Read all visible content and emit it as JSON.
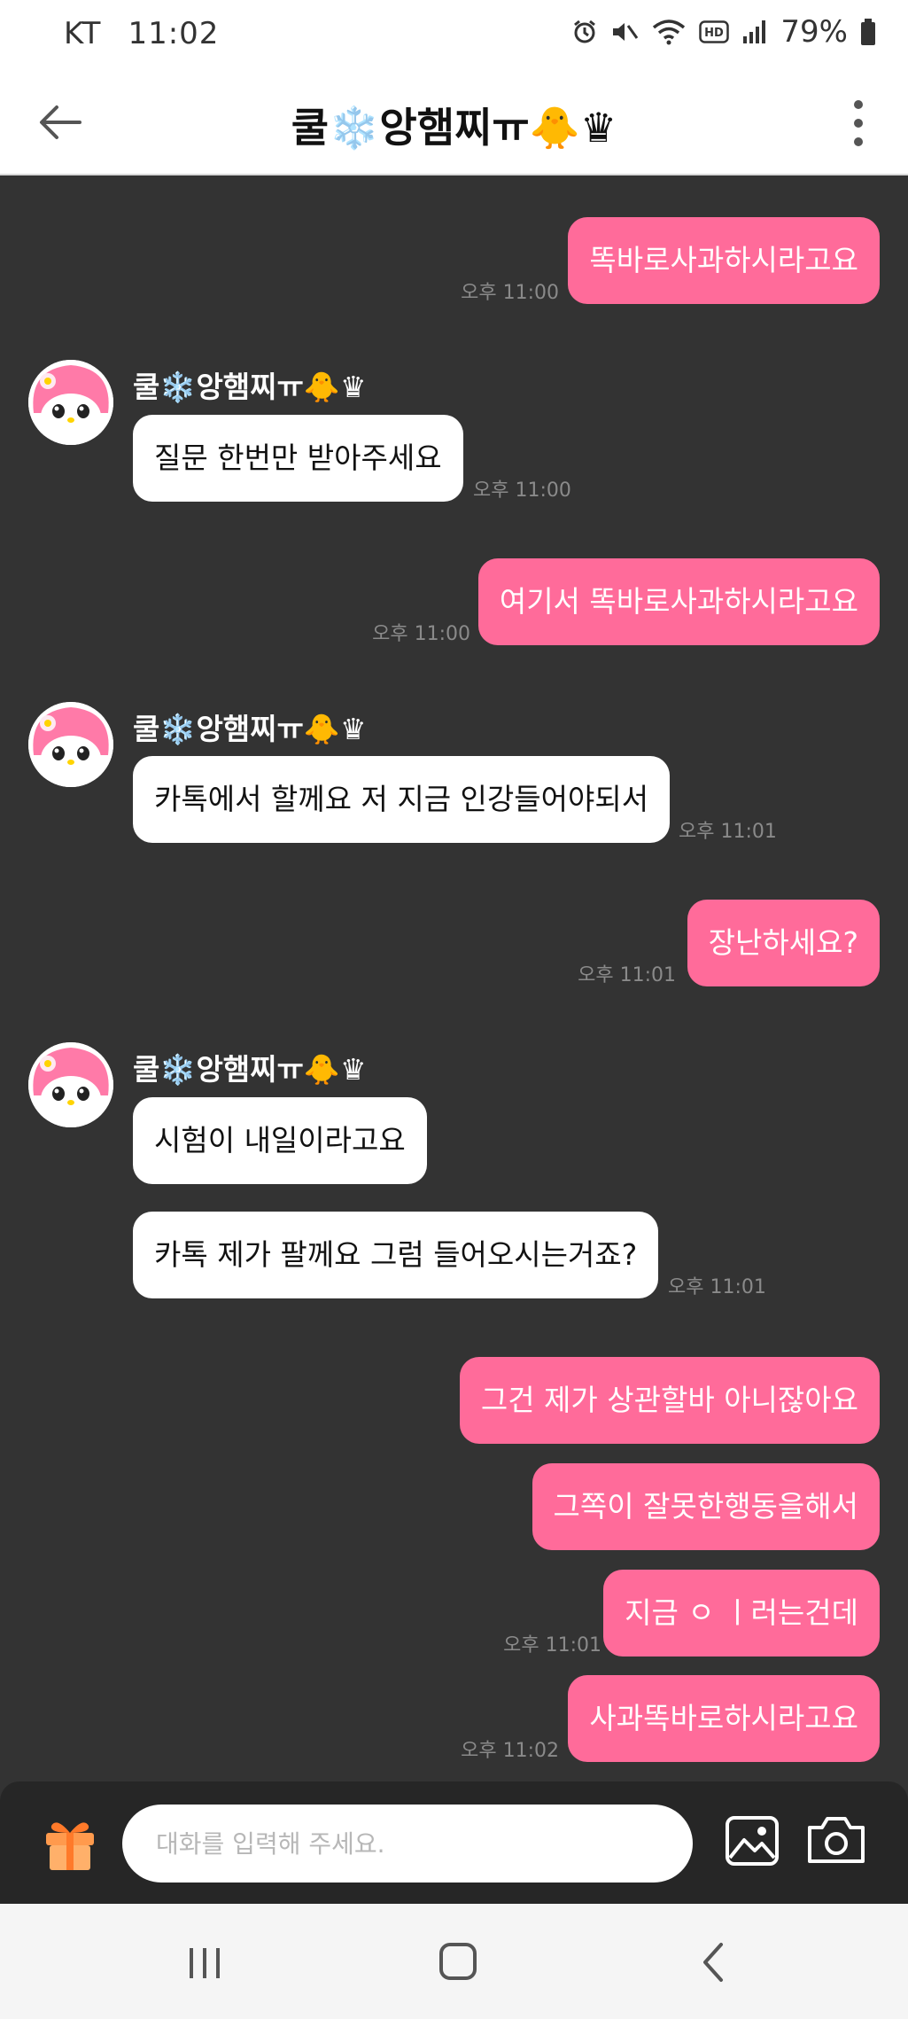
{
  "status_bar": {
    "carrier": "KT",
    "time": "11:02",
    "battery": "79%",
    "icons": [
      "alarm-icon",
      "mute-icon",
      "wifi-icon",
      "hd-icon",
      "signal-icon",
      "battery-icon"
    ]
  },
  "header": {
    "title": "쿨❄️앙햄찌ㅠ🐥♛",
    "back_icon": "back-arrow-icon",
    "menu_icon": "more-vert-icon"
  },
  "sender": {
    "name": "쿨❄️앙햄찌ㅠ🐥♛",
    "avatar": "my-melody-avatar"
  },
  "messages": [
    {
      "direction": "out",
      "text": "똑바로사과하시라고요",
      "time": "오후 11:00"
    },
    {
      "direction": "in",
      "text": "질문 한번만 받아주세요",
      "time": "오후 11:00"
    },
    {
      "direction": "out",
      "text": "여기서 똑바로사과하시라고요",
      "time": "오후 11:00"
    },
    {
      "direction": "in",
      "text": "카톡에서 할께요 저 지금 인강들어야되서",
      "time": "오후 11:01"
    },
    {
      "direction": "out",
      "text": "장난하세요?",
      "time": "오후 11:01"
    },
    {
      "direction": "in",
      "text": "시험이 내일이라고요",
      "time": ""
    },
    {
      "direction": "in",
      "text": "카톡 제가 팔께요 그럼 들어오시는거죠?",
      "time": "오후 11:01"
    },
    {
      "direction": "out",
      "text": "그건 제가 상관할바 아니잖아요",
      "time": ""
    },
    {
      "direction": "out",
      "text": "그쪽이 잘못한행동을해서",
      "time": ""
    },
    {
      "direction": "out",
      "text": "지금 ㅇ ㅣ러는건데",
      "time": "오후 11:01"
    },
    {
      "direction": "out",
      "text": "사과똑바로하시라고요",
      "time": "오후 11:02"
    }
  ],
  "input": {
    "placeholder": "대화를 입력해 주세요.",
    "value": ""
  },
  "colors": {
    "outgoing_bubble": "#ff6b9a",
    "incoming_bubble": "#ffffff",
    "chat_background": "#333333"
  },
  "nav_bar": {
    "icons": [
      "recent-apps-icon",
      "home-icon",
      "back-icon"
    ]
  }
}
